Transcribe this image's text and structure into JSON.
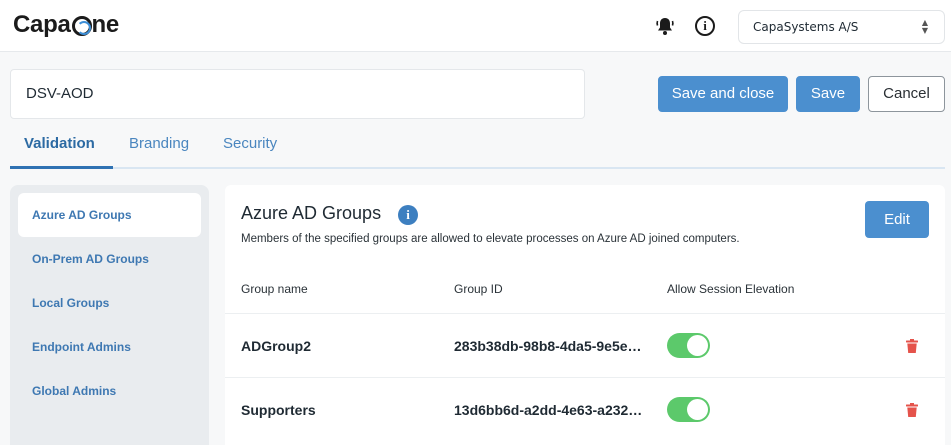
{
  "header": {
    "logo_text_left": "Capa",
    "logo_text_right": "ne",
    "organization": "CapaSystems A/S",
    "icons": {
      "notifications": "bell-icon",
      "info": "info-icon",
      "select": "chevron-updown-icon"
    }
  },
  "form": {
    "title_value": "DSV-AOD",
    "save_and_close_label": "Save and close",
    "save_label": "Save",
    "cancel_label": "Cancel"
  },
  "tabs": [
    {
      "label": "Validation",
      "active": true
    },
    {
      "label": "Branding",
      "active": false
    },
    {
      "label": "Security",
      "active": false
    }
  ],
  "sidebar": {
    "items": [
      {
        "label": "Azure AD Groups",
        "active": true
      },
      {
        "label": "On-Prem AD Groups",
        "active": false
      },
      {
        "label": "Local Groups",
        "active": false
      },
      {
        "label": "Endpoint Admins",
        "active": false
      },
      {
        "label": "Global Admins",
        "active": false
      }
    ]
  },
  "panel": {
    "title": "Azure AD Groups",
    "description": "Members of the specified groups are allowed to elevate processes on Azure AD joined computers.",
    "edit_label": "Edit",
    "columns": [
      "Group name",
      "Group ID",
      "Allow Session Elevation"
    ],
    "rows": [
      {
        "name": "ADGroup2",
        "id": "283b38db-98b8-4da5-9e5e…",
        "allow": true
      },
      {
        "name": "Supporters",
        "id": "13d6bb6d-a2dd-4e63-a232…",
        "allow": true
      }
    ]
  },
  "colors": {
    "accent": "#4b8fcf",
    "toggle_on": "#5cc96b",
    "delete": "#e5534b",
    "tab_active": "#2c6aa3"
  }
}
